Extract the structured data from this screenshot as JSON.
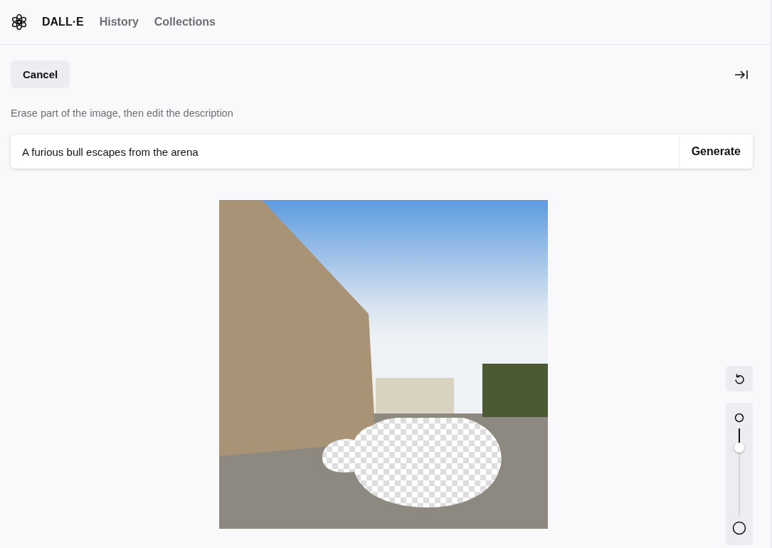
{
  "header": {
    "brand": "DALL·E",
    "nav": [
      {
        "label": "History"
      },
      {
        "label": "Collections"
      }
    ]
  },
  "toolbar": {
    "cancel": "Cancel"
  },
  "instruction": "Erase part of the image, then edit the description",
  "prompt": {
    "value": "A furious bull escapes from the arena",
    "button": "Generate"
  },
  "brush_size": {
    "level": 0.22
  }
}
